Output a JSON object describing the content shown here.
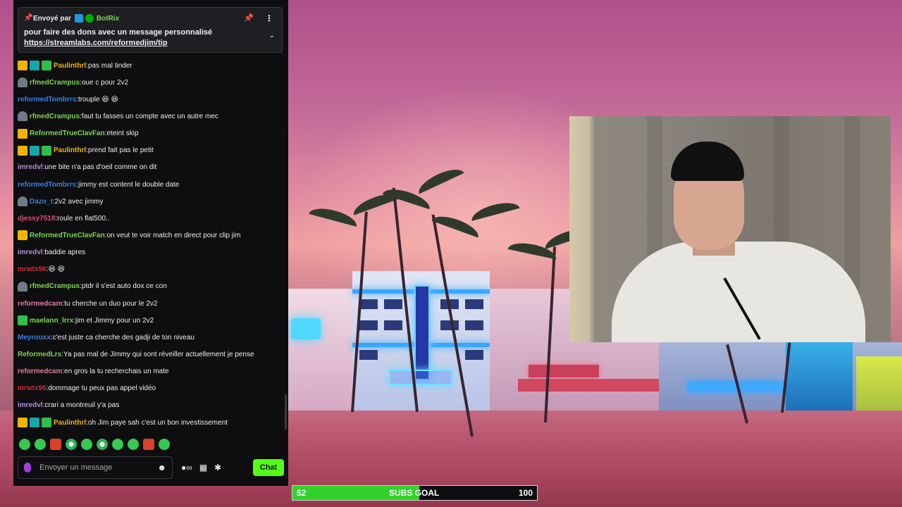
{
  "pinned": {
    "sender_prefix": "Envoyé par",
    "bot_name": "BotRix",
    "message": "pour faire des dons avec un message personnalisé",
    "link": "https://streamlabs.com/reformedjim/tip",
    "icons": [
      "pin-icon",
      "more-options-icon",
      "chevron-down-icon"
    ]
  },
  "messages": [
    {
      "badges": [
        "crown",
        "rk",
        "gift"
      ],
      "user": "Paulinthrl",
      "color": "#f0b400",
      "text": "pas mal tinder"
    },
    {
      "badges": [
        "person"
      ],
      "user": "rfmedCrampus",
      "color": "#7bd64c",
      "text": "oue c pour 2v2"
    },
    {
      "badges": [],
      "user": "reformedTombrrs",
      "color": "#3a7fe0",
      "text": "trouple 😆 😆"
    },
    {
      "badges": [
        "person"
      ],
      "user": "rfmedCrampus",
      "color": "#7bd64c",
      "text": "faut tu fasses un compte avec un autre mec"
    },
    {
      "badges": [
        "crown"
      ],
      "user": "ReformedTrueClavFan",
      "color": "#7bd64c",
      "text": "eteint skip"
    },
    {
      "badges": [
        "crown",
        "rk",
        "gift"
      ],
      "user": "Paulinthrl",
      "color": "#f0b400",
      "text": "prend fait pas le petit"
    },
    {
      "badges": [],
      "user": "imredvl",
      "color": "#b58ad8",
      "text": "une bite n'a pas d'oeil comme on dit"
    },
    {
      "badges": [],
      "user": "reformedTombrrs",
      "color": "#3a7fe0",
      "text": "jimmy est content le double date"
    },
    {
      "badges": [
        "person"
      ],
      "user": "Dazo_t",
      "color": "#3a7fe0",
      "text": "2v2 avec jimmy"
    },
    {
      "badges": [],
      "user": "djessy7518",
      "color": "#e04a7a",
      "text": "roule en flat500.."
    },
    {
      "badges": [
        "crown"
      ],
      "user": "ReformedTrueClavFan",
      "color": "#7bd64c",
      "text": "on veut te voir match en direct pour clip jim"
    },
    {
      "badges": [],
      "user": "imredvl",
      "color": "#b58ad8",
      "text": "baddie apres"
    },
    {
      "badges": [],
      "user": "mrwtx96",
      "color": "#d8262e",
      "text": "😆 😆"
    },
    {
      "badges": [
        "person"
      ],
      "user": "rfmedCrampus",
      "color": "#7bd64c",
      "text": "ptdr il s'est auto dox ce con"
    },
    {
      "badges": [],
      "user": "reformedcam",
      "color": "#e07aa0",
      "text": "tu cherche un duo pour le 2v2"
    },
    {
      "badges": [
        "gift"
      ],
      "user": "maelann_lrrx",
      "color": "#7bd64c",
      "text": "jim et Jimmy pour un 2v2"
    },
    {
      "badges": [],
      "user": "Meyrouxx",
      "color": "#3a7fe0",
      "text": "c'est juste ca cherche des gadji de ton niveau"
    },
    {
      "badges": [],
      "user": "ReformedLrs",
      "color": "#7bd64c",
      "text": "Ya pas mal de Jimmy qui sont réveiller actuellement je pense"
    },
    {
      "badges": [],
      "user": "reformedcam",
      "color": "#e07aa0",
      "text": "en gros la tu recherchais un mate"
    },
    {
      "badges": [],
      "user": "mrwtx96",
      "color": "#d8262e",
      "text": "dommage tu peux pas appel vidéo"
    },
    {
      "badges": [],
      "user": "imredvl",
      "color": "#b58ad8",
      "text": "crari a montreuil y'a pas"
    },
    {
      "badges": [
        "crown",
        "rk",
        "gift"
      ],
      "user": "Paulinthrl",
      "color": "#f0b400",
      "text": "oh Jim paye sah c'est un bon investissement"
    }
  ],
  "emote_bar": [
    "emote-green",
    "emote-green",
    "emote-red",
    "emote-mix",
    "emote-green",
    "emote-mix",
    "emote-green",
    "emote-green",
    "emote-red",
    "emote-green"
  ],
  "input": {
    "placeholder": "Envoyer un message",
    "value": ""
  },
  "send_label": "Chat",
  "subs_goal": {
    "current": "52",
    "label": "SUBS GOAL",
    "target": "100",
    "progress_fraction": 0.52
  },
  "colors": {
    "accent_green": "#53fc18",
    "goal_green": "#32d22a",
    "panel_bg": "#0e0e10"
  }
}
